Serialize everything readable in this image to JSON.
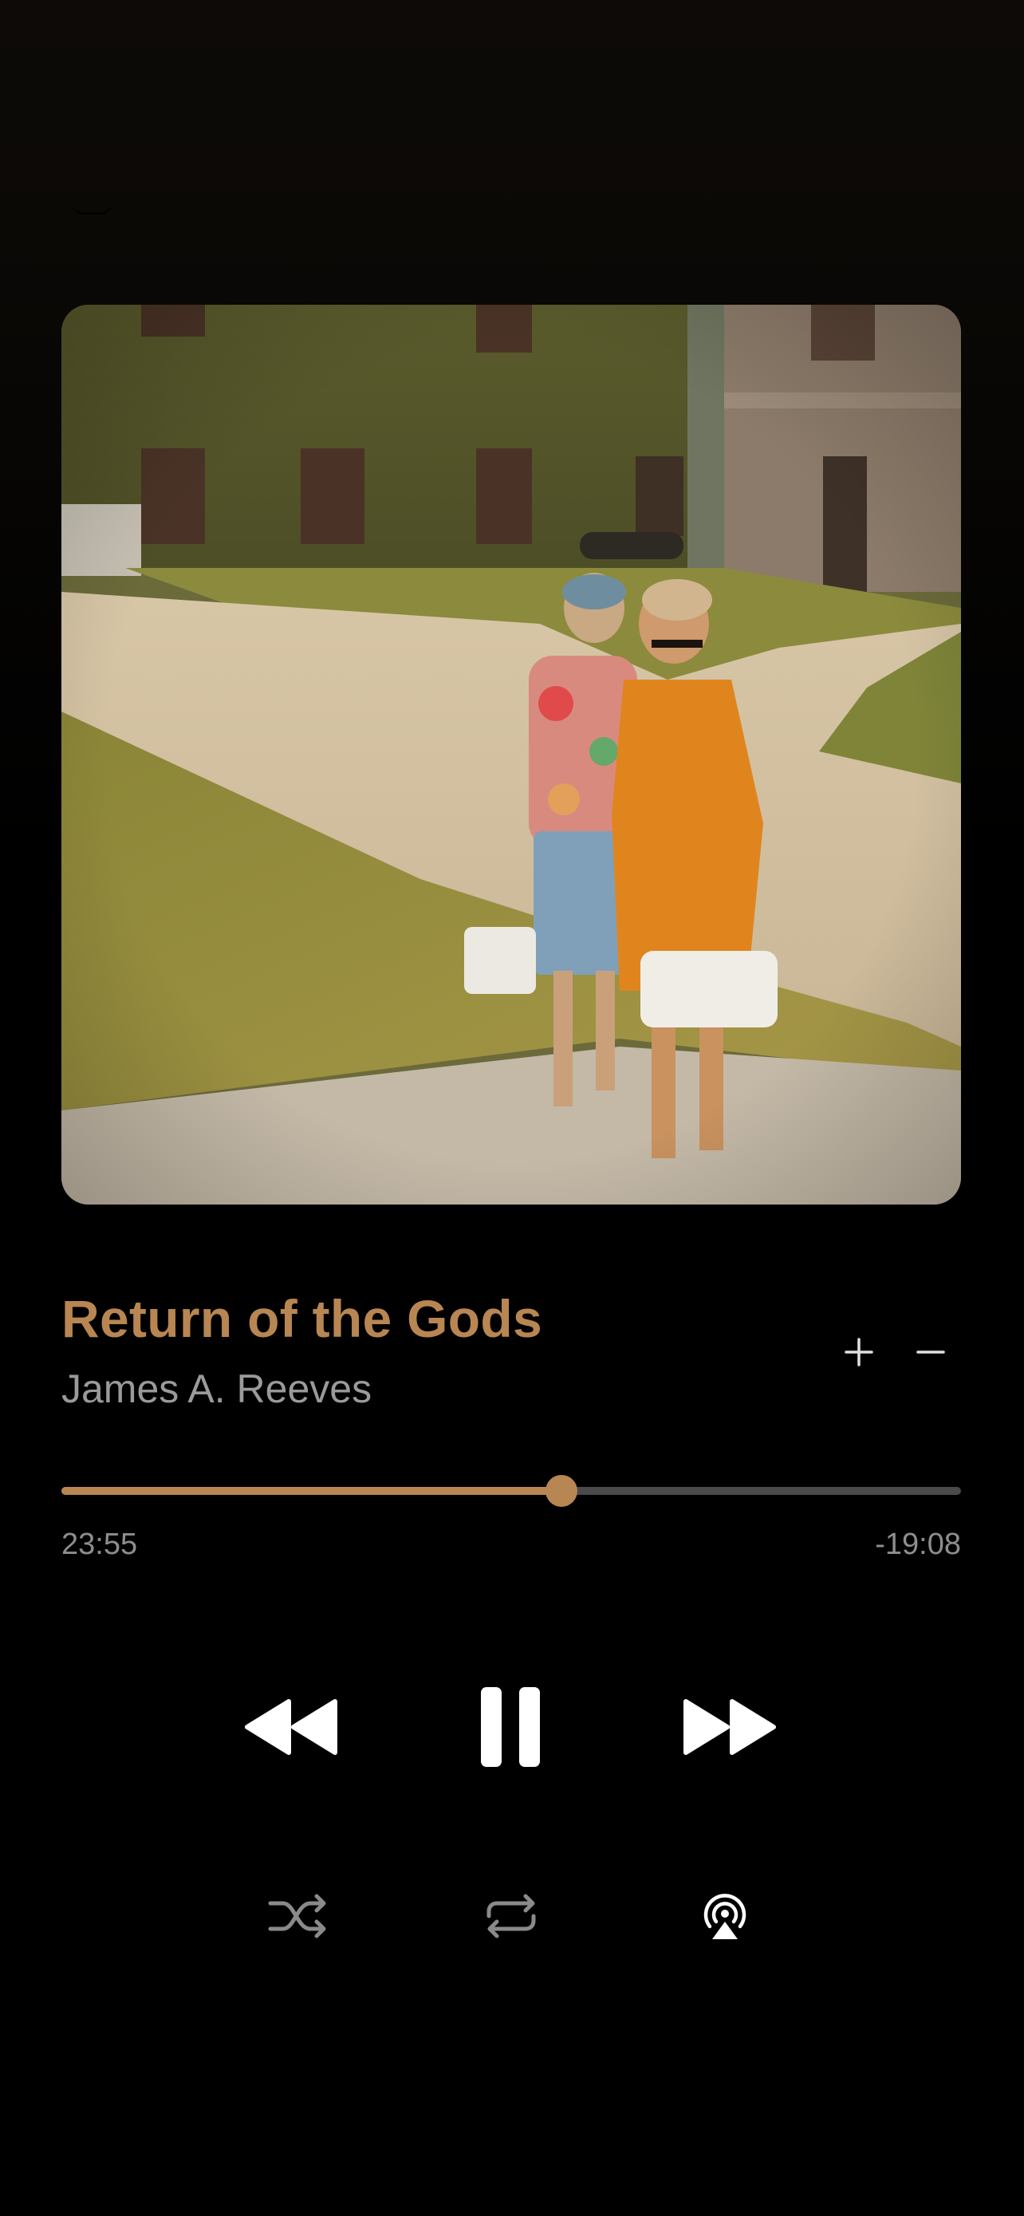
{
  "now_playing": {
    "title": "Return of the Gods",
    "artist": "James A. Reeves",
    "elapsed": "23:55",
    "remaining": "-19:08",
    "progress_fraction": 0.556
  },
  "icons": {
    "grabber": "dismiss-handle-icon",
    "plus": "plus-icon",
    "minus": "minus-icon",
    "rewind": "rewind-icon",
    "pause": "pause-icon",
    "forward": "fast-forward-icon",
    "shuffle": "shuffle-icon",
    "repeat": "repeat-icon",
    "airplay": "airplay-icon"
  },
  "colors": {
    "accent": "#b88652",
    "background": "#000000",
    "secondary_text": "#9a9a9a",
    "track": "#4a4a4a"
  }
}
